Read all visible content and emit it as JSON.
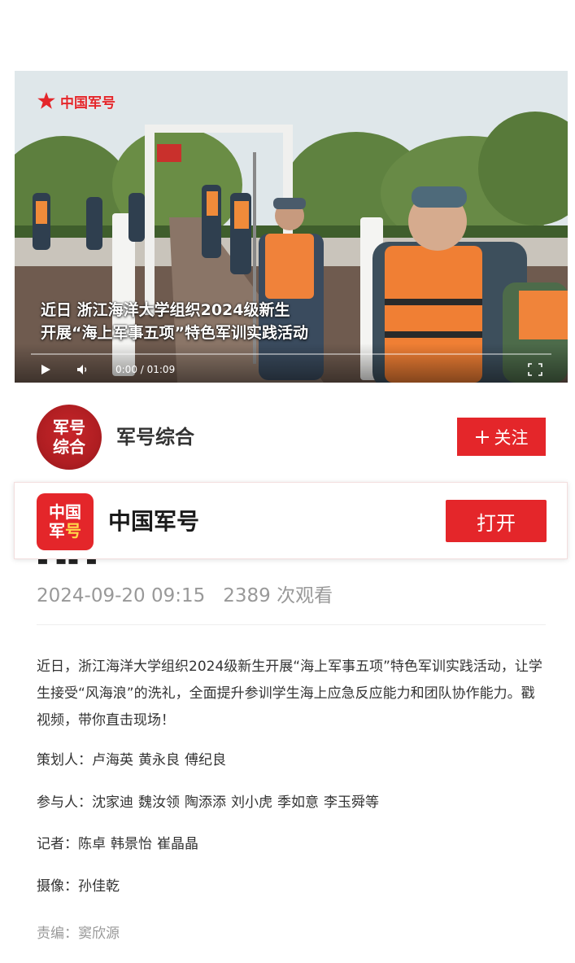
{
  "video": {
    "watermark": "中国军号",
    "caption_line1": "近日 浙江海洋大学组织2024级新生",
    "caption_line2": "开展“海上军事五项”特色军训实践活动",
    "time": "0:00 / 01:09",
    "progress": 0,
    "play_icon": "play-icon",
    "volume_icon": "volume-icon",
    "fullscreen_icon": "fullscreen-icon"
  },
  "author": {
    "avatar_line1": "军号",
    "avatar_line2": "综合",
    "name": "军号综合",
    "follow_label": "关注",
    "follow_icon": "plus-icon"
  },
  "app_banner": {
    "logo_line1": "中国",
    "logo_line2_a": "军",
    "logo_line2_b": "号",
    "name": "中国军号",
    "open_label": "打开"
  },
  "meta": {
    "datetime": "2024-09-20 09:15",
    "views": "2389 次观看"
  },
  "article": {
    "paragraph": "近日，浙江海洋大学组织2024级新生开展“海上军事五项”特色军训实践活动，让学生接受“风海浪”的洗礼，全面提升参训学生海上应急反应能力和团队协作能力。戳视频，带你直击现场！",
    "planner_label": "策划人：",
    "planners": [
      "卢海英",
      "黄永良",
      "傅纪良"
    ],
    "participants_label": "参与人：",
    "participants": [
      "沈家迪",
      "魏汝领",
      "陶添添",
      "刘小虎",
      "季如意",
      "李玉舜等"
    ],
    "reporter_label": "记者：",
    "reporters": [
      "陈卓",
      "韩景怡",
      "崔晶晶"
    ],
    "camera_label": "摄像：",
    "camera": [
      "孙佳乾"
    ],
    "editor_label": "责编：",
    "editor": "窦欣源"
  },
  "colors": {
    "brand_red": "#e4262a",
    "muted_gray": "#999999",
    "logo_yellow": "#ffd84a"
  }
}
